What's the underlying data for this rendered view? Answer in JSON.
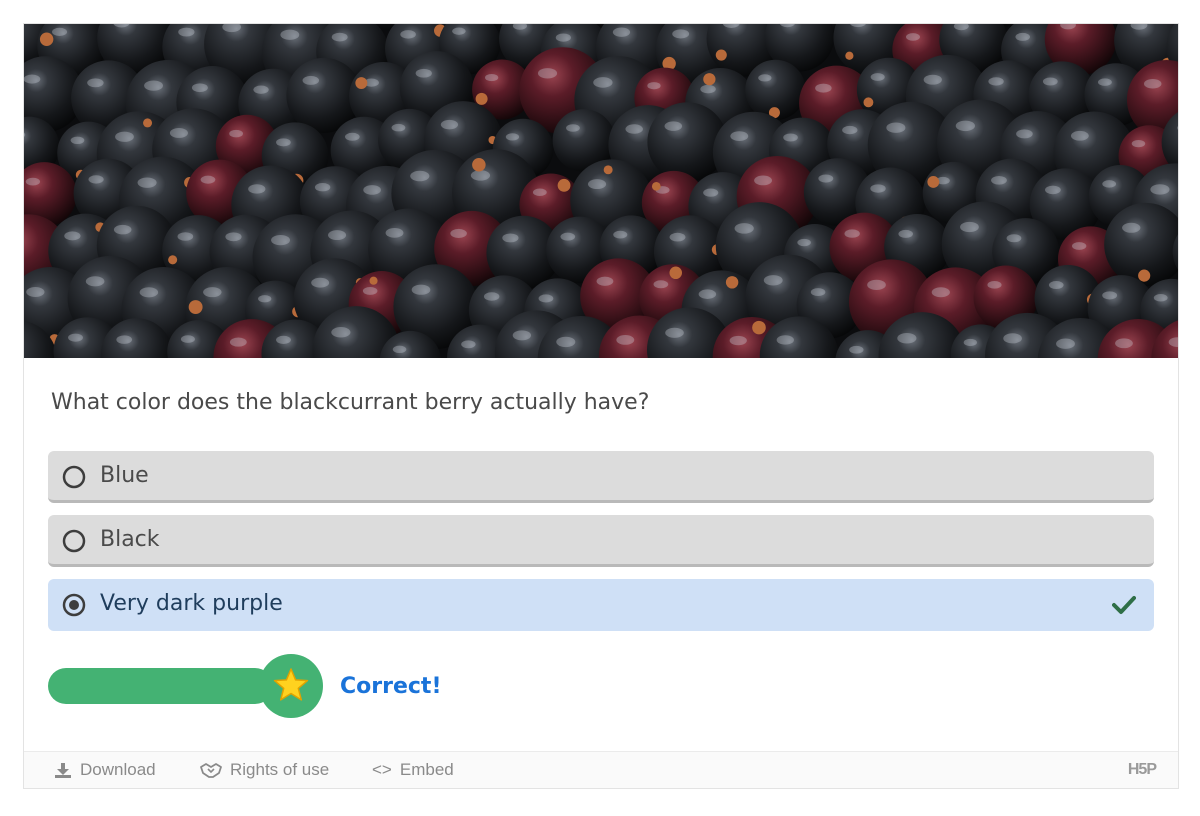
{
  "hero_image": {
    "description_icon": "blackcurrant-berries-photo"
  },
  "question": {
    "text": "What color does the blackcurrant berry actually have?"
  },
  "answers": [
    {
      "label": "Blue",
      "selected": false,
      "correct": false
    },
    {
      "label": "Black",
      "selected": false,
      "correct": false
    },
    {
      "label": "Very dark purple",
      "selected": true,
      "correct": true
    }
  ],
  "result": {
    "score_fraction": 1.0,
    "feedback": "Correct!",
    "bar_color": "#44b273",
    "feedback_color": "#1a73d9"
  },
  "footer": {
    "download_label": "Download",
    "rights_label": "Rights of use",
    "embed_label": "Embed",
    "embed_icon": "<>",
    "logo_text": "H5P"
  },
  "colors": {
    "answer_bg": "#dcdcdc",
    "selected_bg": "#cfe0f6",
    "check": "#2f6f47"
  }
}
